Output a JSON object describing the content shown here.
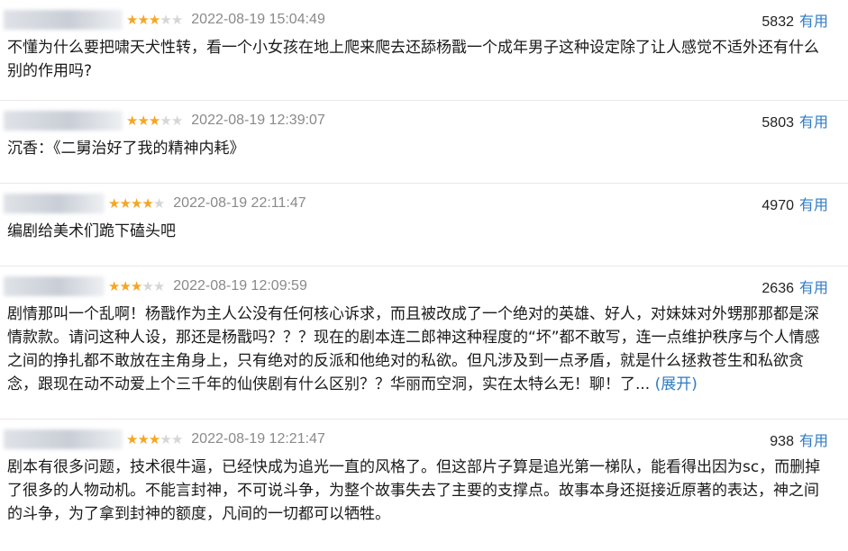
{
  "colors": {
    "star": "#f5a623",
    "star_empty": "#d6d6d6",
    "link": "#2f7bc4",
    "time": "#8a8a8a"
  },
  "comments": [
    {
      "stars": 3,
      "time": "2022-08-19 15:04:49",
      "votes": "5832",
      "useful_label": "有用",
      "text": "不懂为什么要把啸天犬性转，看一个小女孩在地上爬来爬去还舔杨戬一个成年男子这种设定除了让人感觉不适外还有什么别的作用吗?",
      "expand": ""
    },
    {
      "stars": 3,
      "time": "2022-08-19 12:39:07",
      "votes": "5803",
      "useful_label": "有用",
      "text": "沉香：《二舅治好了我的精神内耗》",
      "expand": ""
    },
    {
      "stars": 4,
      "time": "2022-08-19 22:11:47",
      "votes": "4970",
      "useful_label": "有用",
      "text": "编剧给美术们跪下磕头吧",
      "expand": ""
    },
    {
      "stars": 3,
      "time": "2022-08-19 12:09:59",
      "votes": "2636",
      "useful_label": "有用",
      "text": "剧情那叫一个乱啊！杨戬作为主人公没有任何核心诉求，而且被改成了一个绝对的英雄、好人，对妹妹对外甥那那都是深情款款。请问这种人设，那还是杨戬吗？？？现在的剧本连二郎神这种程度的“坏”都不敢写，连一点维护秩序与个人情感之间的挣扎都不敢放在主角身上，只有绝对的反派和他绝对的私欲。但凡涉及到一点矛盾，就是什么拯救苍生和私欲贪念，跟现在动不动爱上个三千年的仙侠剧有什么区别？？华丽而空洞，实在太特么无！聊！了... ",
      "expand": "(展开)"
    },
    {
      "stars": 3,
      "time": "2022-08-19 12:21:47",
      "votes": "938",
      "useful_label": "有用",
      "text": "剧本有很多问题，技术很牛逼，已经快成为追光一直的风格了。但这部片子算是追光第一梯队，能看得出因为sc，而删掉了很多的人物动机。不能言封神，不可说斗争，为整个故事失去了主要的支撑点。故事本身还挺接近原著的表达，神之间的斗争，为了拿到封神的额度，凡间的一切都可以牺牲。",
      "expand": ""
    }
  ]
}
